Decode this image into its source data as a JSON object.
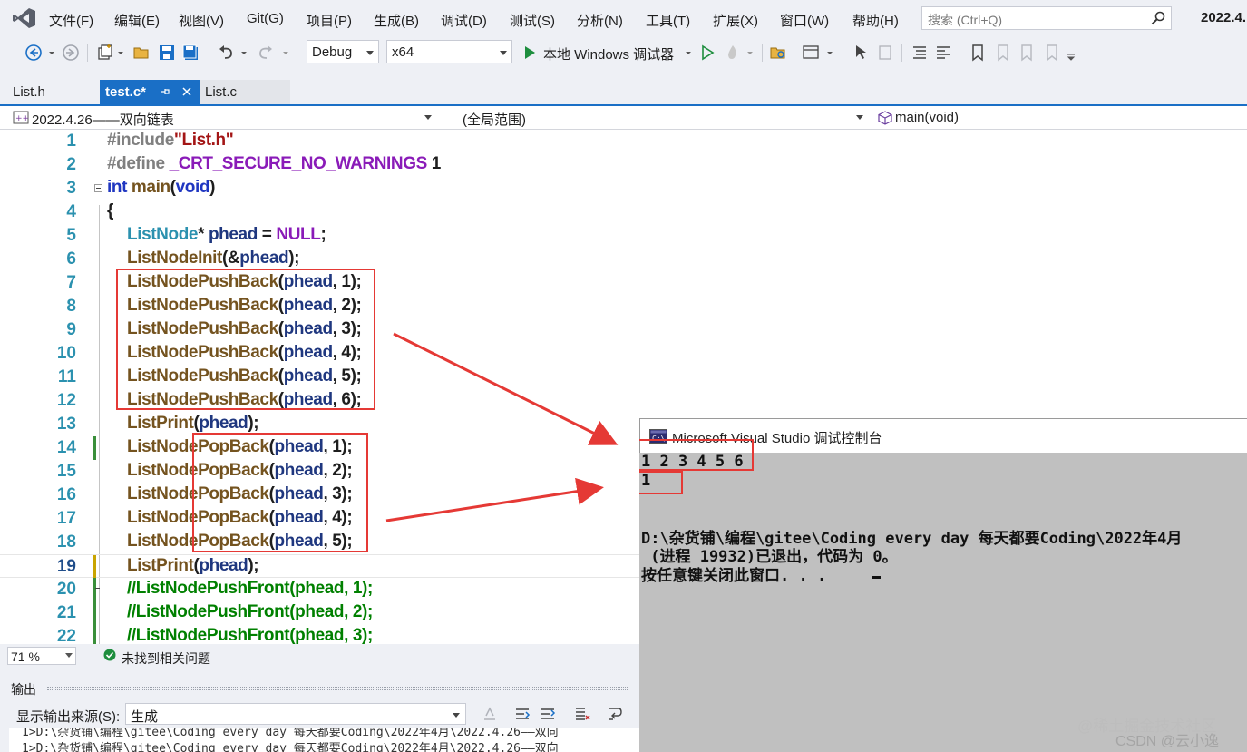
{
  "menu": {
    "items": [
      "文件(F)",
      "编辑(E)",
      "视图(V)",
      "Git(G)",
      "项目(P)",
      "生成(B)",
      "调试(D)",
      "测试(S)",
      "分析(N)",
      "工具(T)",
      "扩展(X)",
      "窗口(W)",
      "帮助(H)"
    ],
    "search_placeholder": "搜索 (Ctrl+Q)",
    "window_title": "2022.4."
  },
  "toolbar": {
    "config": "Debug",
    "platform": "x64",
    "run_label": "本地 Windows 调试器"
  },
  "tabs": [
    {
      "label": "List.h"
    },
    {
      "label": "test.c*"
    },
    {
      "label": "List.c"
    }
  ],
  "navbar": {
    "project": "2022.4.26——双向链表",
    "scope": "(全局范围)",
    "member": "main(void)"
  },
  "editor": {
    "line_numbers": [
      "1",
      "2",
      "3",
      "4",
      "5",
      "6",
      "7",
      "8",
      "9",
      "10",
      "11",
      "12",
      "13",
      "14",
      "15",
      "16",
      "17",
      "18",
      "19",
      "20",
      "21",
      "22"
    ],
    "l1": {
      "a": "#include",
      "b": "\"List.h\""
    },
    "l2": {
      "a": "#define ",
      "b": "_CRT_SECURE_NO_WARNINGS",
      "c": " 1"
    },
    "l3": {
      "a": "int ",
      "b": "main",
      "c": "(",
      "d": "void",
      "e": ")"
    },
    "l4": {
      "a": "{"
    },
    "l5": {
      "a": "ListNode",
      "b": "* ",
      "c": "phead",
      "d": " = ",
      "e": "NULL",
      "f": ";"
    },
    "l6": {
      "a": "ListNodeInit",
      "b": "(&",
      "c": "phead",
      "d": ");"
    },
    "push_fn": "ListNodePushBack",
    "pop_fn": "ListNodePopBack",
    "print_fn": "ListPrint",
    "var": "phead",
    "push_args": [
      "1",
      "2",
      "3",
      "4",
      "5",
      "6"
    ],
    "pop_args": [
      "1",
      "2",
      "3",
      "4",
      "5"
    ],
    "comments": [
      "//ListNodePushFront(phead, 1);",
      "//ListNodePushFront(phead, 2);",
      "//ListNodePushFront(phead, 3);"
    ]
  },
  "status": {
    "zoom": "71 %",
    "issues": "未找到相关问题"
  },
  "output": {
    "title": "输出",
    "source_label": "显示输出来源(S):",
    "source_value": "生成",
    "lines": [
      "1>D:\\杂货铺\\编程\\gitee\\Coding every day 每天都要Coding\\2022年4月\\2022.4.26——双向",
      "1>D:\\杂货铺\\编程\\gitee\\Coding every day 每天都要Coding\\2022年4月\\2022.4.26——双向"
    ]
  },
  "console": {
    "title": "Microsoft Visual Studio 调试控制台",
    "lines": [
      "1 2 3 4 5 6",
      "1",
      "",
      "",
      "D:\\杂货铺\\编程\\gitee\\Coding every day 每天都要Coding\\2022年4月",
      " (进程 19932)已退出，代码为 0。",
      "按任意键关闭此窗口. . ."
    ]
  },
  "watermark": {
    "line1": "@稀土掘金技术社区",
    "line2": "CSDN @云小逸"
  }
}
